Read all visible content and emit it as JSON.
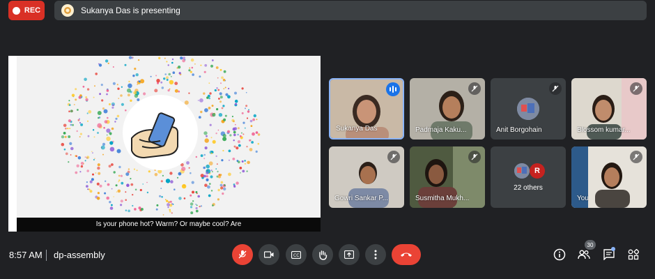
{
  "recording": {
    "label": "REC",
    "color": "#d93025"
  },
  "presenting": {
    "text": "Sukanya Das is presenting"
  },
  "slide": {
    "caption": "Is your phone hot? Warm? Or maybe cool? Are"
  },
  "participants": [
    {
      "name": "Sukanya Das",
      "state": "speaking"
    },
    {
      "name": "Padmaja Kaku...",
      "state": "muted"
    },
    {
      "name": "Anit Borgohain",
      "state": "muted"
    },
    {
      "name": "Blossom kumar...",
      "state": "muted"
    },
    {
      "name": "Gowri Sankar P...",
      "state": "muted"
    },
    {
      "name": "Susmitha Mukh...",
      "state": "muted"
    },
    {
      "name": "22 others",
      "avatar_letter": "R"
    },
    {
      "name": "You",
      "state": "muted"
    }
  ],
  "bottom": {
    "time": "8:57 AM",
    "meeting_code": "dp-assembly",
    "participant_count": "30"
  },
  "controls": [
    "mic-off-icon",
    "camera-icon",
    "captions-icon",
    "raise-hand-icon",
    "present-icon",
    "more-options-icon",
    "leave-call-icon"
  ],
  "right_controls": [
    "info-icon",
    "people-icon",
    "chat-icon",
    "activities-icon"
  ],
  "colors": {
    "background": "#202124",
    "tile": "#3c4043",
    "accent": "#8ab4f8",
    "danger": "#ea4335"
  }
}
